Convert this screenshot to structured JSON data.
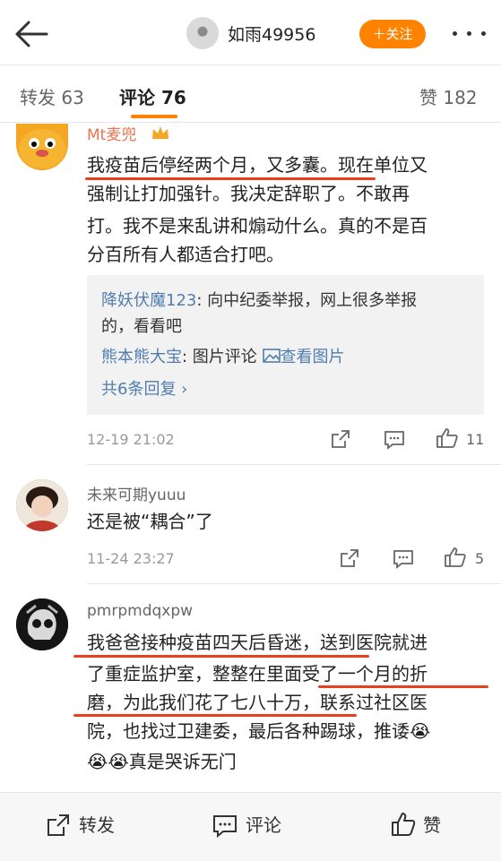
{
  "header": {
    "username": "如雨49956",
    "follow_label": "＋关注"
  },
  "tabs": {
    "repost": "转发 63",
    "comments": "评论 76",
    "likes": "赞 182"
  },
  "comments": [
    {
      "user": "Mt麦兜",
      "lines": [
        "我疫苗后停经两个月，又多囊。现在单位又",
        "强制让打加强针。我决定辞职了。不敢再",
        "打。我不是来乱讲和煽动什么。真的不是百",
        "分百所有人都适合打吧。"
      ],
      "replies": {
        "r1_name": "降妖伏魔123",
        "r1_text_a": ": 向中纪委举报，网上很多举报",
        "r1_text_b": "的，看看吧",
        "r2_name": "熊本熊大宝",
        "r2_text": ": 图片评论 ",
        "r2_link": "查看图片",
        "more": "共6条回复 ›"
      },
      "time": "12-19 21:02",
      "likes": "11"
    },
    {
      "user": "未来可期yuuu",
      "text": "还是被“耦合”了",
      "time": "11-24 23:27",
      "likes": "5"
    },
    {
      "user": "pmrpmdqxpw",
      "lines": [
        "我爸爸接种疫苗四天后昏迷，送到医院就进",
        "了重症监护室，整整在里面受了一个月的折",
        "磨，为此我们花了七八十万，联系过社区医",
        "院，也找过卫建委，最后各种踢球，推诿😭"
      ],
      "last_line": "😭😭真是哭诉无门"
    }
  ],
  "bottom_bar": {
    "repost": "转发",
    "comment": "评论",
    "like": "赞"
  }
}
